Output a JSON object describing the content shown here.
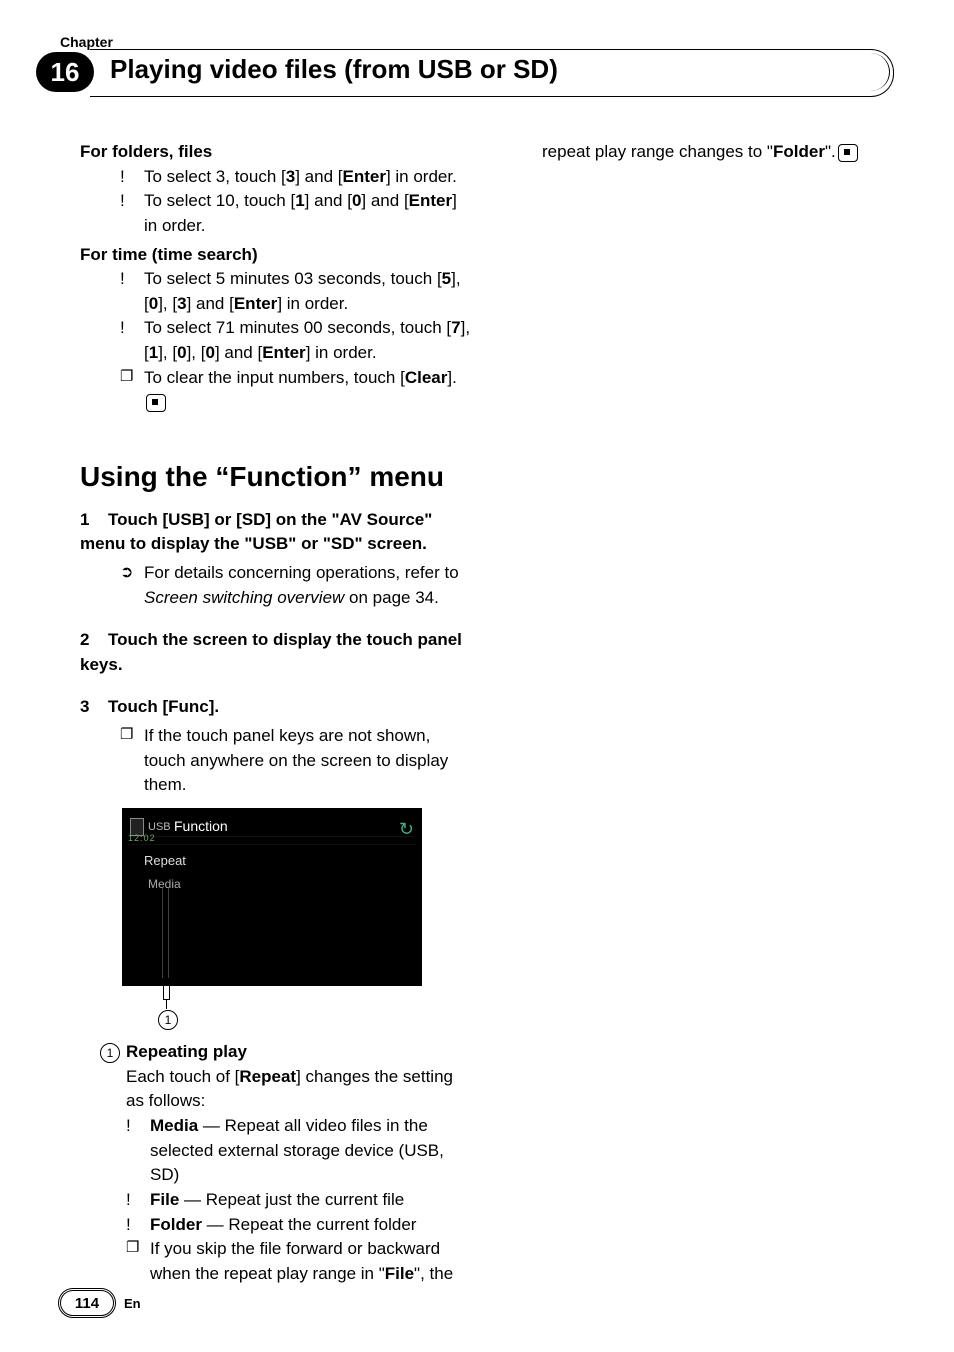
{
  "header": {
    "chapter_label": "Chapter",
    "chapter_number": "16",
    "title": "Playing video files (from USB or SD)"
  },
  "left": {
    "h_folders": "For folders, files",
    "b1a": "To select 3, touch [",
    "b1b": "3",
    "b1c": "] and [",
    "b1d": "Enter",
    "b1e": "] in order.",
    "b2a": "To select 10, touch [",
    "b2b": "1",
    "b2c": "] and [",
    "b2d": "0",
    "b2e": "] and [",
    "b2f": "Enter",
    "b2g": "] in order.",
    "h_time": "For time (time search)",
    "t1a": "To select 5 minutes 03 seconds, touch [",
    "t1b": "5",
    "t1c": "], [",
    "t1d": "0",
    "t1e": "], [",
    "t1f": "3",
    "t1g": "] and [",
    "t1h": "Enter",
    "t1i": "] in order.",
    "t2a": "To select 71 minutes 00 seconds, touch [",
    "t2b": "7",
    "t2c": "], [",
    "t2d": "1",
    "t2e": "], [",
    "t2f": "0",
    "t2g": "], [",
    "t2h": "0",
    "t2i": "] and [",
    "t2j": "Enter",
    "t2k": "] in order.",
    "n1a": "To clear the input numbers, touch [",
    "n1b": "Clear",
    "n1c": "].",
    "section_title_pre": "Using the “",
    "section_title_fn": "Function",
    "section_title_post": "” menu",
    "s1": "Touch [USB] or [SD] on the \"AV Source\" menu to display the \"USB\" or \"SD\" screen.",
    "s1_num": "1",
    "s1_ref_a": "For details concerning operations, refer to ",
    "s1_ref_b": "Screen switching overview",
    "s1_ref_c": " on page 34.",
    "s2_num": "2",
    "s2": "Touch the screen to display the touch panel keys.",
    "s3_num": "3",
    "s3": "Touch [Func].",
    "s3_note": "If the touch panel keys are not shown, touch anywhere on the screen to display them.",
    "scr": {
      "usb": "USB",
      "fn": "Function",
      "time": "12:02",
      "repeat": "Repeat",
      "media": "Media",
      "back": "↻"
    },
    "callout": "1",
    "rp_head": "Repeating play",
    "rp_txt_a": "Each touch of [",
    "rp_txt_b": "Repeat",
    "rp_txt_c": "] changes the setting as follows:",
    "rp_m_a": "Media",
    "rp_m_b": " — Repeat all video files in the selected external storage device (USB, SD)",
    "rp_f_a": "File",
    "rp_f_b": " — Repeat just the current file",
    "rp_fo_a": "Folder",
    "rp_fo_b": " — Repeat the current folder",
    "rp_note_a": "If you skip the file forward or backward when the repeat play range in \"",
    "rp_note_b": "File",
    "rp_note_c": "\", the"
  },
  "right": {
    "cont_a": "repeat play range changes to \"",
    "cont_b": "Folder",
    "cont_c": "\"."
  },
  "footer": {
    "page": "114",
    "lang": "En"
  }
}
